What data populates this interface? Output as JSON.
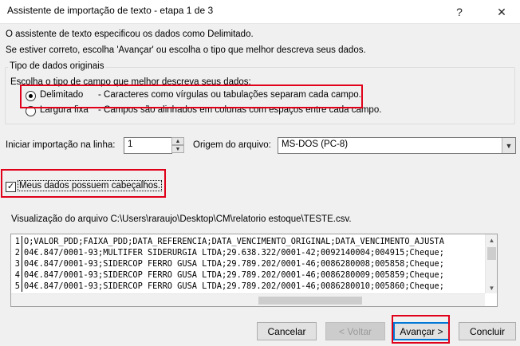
{
  "window": {
    "title": "Assistente de importação de texto - etapa 1 de 3",
    "help_glyph": "?",
    "close_glyph": "✕"
  },
  "intro": {
    "line1": "O assistente de texto especificou os dados como Delimitado.",
    "line2": "Se estiver correto, escolha 'Avançar' ou escolha o tipo que melhor descreva seus dados."
  },
  "group": {
    "legend": "Tipo de dados originais",
    "prompt": "Escolha o tipo de campo que melhor descreva seus dados:",
    "options": [
      {
        "label": "Delimitado",
        "description": "- Caracteres como vírgulas ou tabulações separam cada campo.",
        "selected": true
      },
      {
        "label": "Largura fixa",
        "description": "- Campos são alinhados em colunas com espaços entre cada campo.",
        "selected": false
      }
    ]
  },
  "start_row": {
    "label": "Iniciar importação na linha:",
    "value": "1"
  },
  "origin": {
    "label": "Origem do arquivo:",
    "value": "MS-DOS (PC-8)"
  },
  "headers_checkbox": {
    "label": "Meus dados possuem cabeçalhos.",
    "checked": true
  },
  "preview": {
    "label": "Visualização do arquivo C:\\Users\\raraujo\\Desktop\\CM\\relatorio estoque\\TESTE.csv.",
    "rows": [
      {
        "num": "1",
        "text": "O;VALOR_PDD;FAIXA_PDD;DATA_REFERENCIA;DATA_VENCIMENTO_ORIGINAL;DATA_VENCIMENTO_AJUSTA"
      },
      {
        "num": "2",
        "text": "04€.847/0001-93;MULTIFER SIDERURGIA LTDA;29.638.322/0001-42;0092140004;004915;Cheque;"
      },
      {
        "num": "3",
        "text": "04€.847/0001-93;SIDERCOP FERRO GUSA LTDA;29.789.202/0001-46;0086280008;005858;Cheque;"
      },
      {
        "num": "4",
        "text": "04€.847/0001-93;SIDERCOP FERRO GUSA LTDA;29.789.202/0001-46;0086280009;005859;Cheque;"
      },
      {
        "num": "5",
        "text": "04€.847/0001-93;SIDERCOP FERRO GUSA LTDA;29.789.202/0001-46;0086280010;005860;Cheque;"
      }
    ]
  },
  "buttons": {
    "cancel": "Cancelar",
    "back": "< Voltar",
    "next": "Avançar >",
    "finish": "Concluir"
  },
  "colors": {
    "highlight": "#e0001a",
    "accent": "#0078d7"
  }
}
